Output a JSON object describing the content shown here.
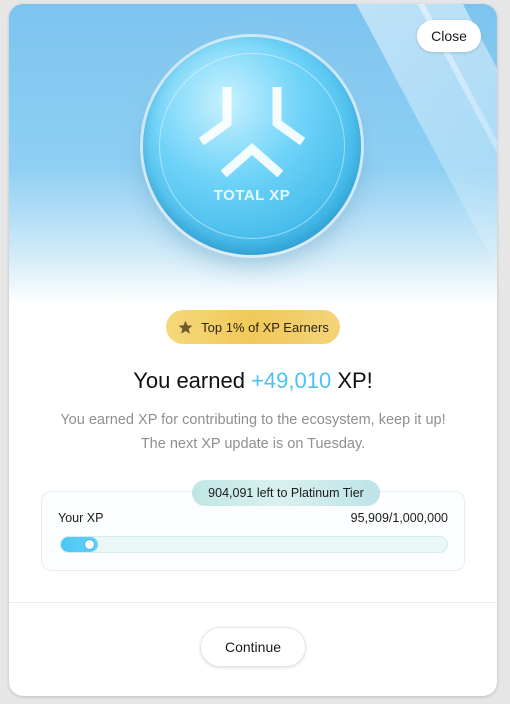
{
  "modal": {
    "close_label": "Close",
    "coin_label": "TOTAL XP",
    "badge": {
      "text": "Top 1% of XP Earners",
      "icon": "star-icon"
    },
    "headline": {
      "prefix": "You earned ",
      "amount": "+49,010",
      "suffix": " XP!"
    },
    "subtext": {
      "line1": "You earned XP for contributing to the ecosystem, keep it up!",
      "line2": "The next XP update is on Tuesday."
    },
    "progress": {
      "tier_text": "904,091 left to Platinum Tier",
      "label": "Your XP",
      "count_text": "95,909/1,000,000",
      "current": 95909,
      "max": 1000000
    },
    "continue_label": "Continue"
  },
  "colors": {
    "accent": "#4bc3f0",
    "badge_gold": "#f1c85a",
    "tier_pill": "#cfeeea"
  }
}
